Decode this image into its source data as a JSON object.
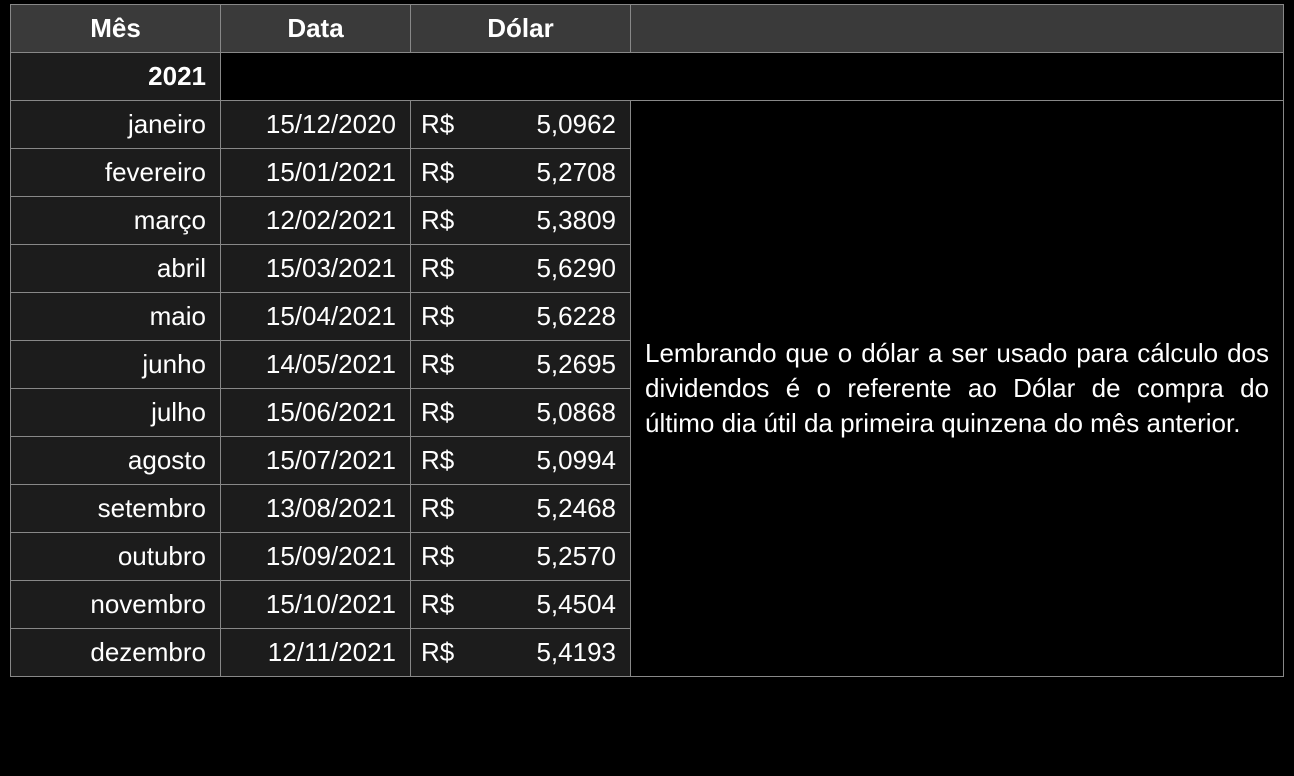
{
  "headers": {
    "month": "Mês",
    "date": "Data",
    "dollar": "Dólar"
  },
  "year": "2021",
  "currency_symbol": "R$",
  "rows": [
    {
      "month": "janeiro",
      "date": "15/12/2020",
      "value": "5,0962"
    },
    {
      "month": "fevereiro",
      "date": "15/01/2021",
      "value": "5,2708"
    },
    {
      "month": "março",
      "date": "12/02/2021",
      "value": "5,3809"
    },
    {
      "month": "abril",
      "date": "15/03/2021",
      "value": "5,6290"
    },
    {
      "month": "maio",
      "date": "15/04/2021",
      "value": "5,6228"
    },
    {
      "month": "junho",
      "date": "14/05/2021",
      "value": "5,2695"
    },
    {
      "month": "julho",
      "date": "15/06/2021",
      "value": "5,0868"
    },
    {
      "month": "agosto",
      "date": "15/07/2021",
      "value": "5,0994"
    },
    {
      "month": "setembro",
      "date": "13/08/2021",
      "value": "5,2468"
    },
    {
      "month": "outubro",
      "date": "15/09/2021",
      "value": "5,2570"
    },
    {
      "month": "novembro",
      "date": "15/10/2021",
      "value": "5,4504"
    },
    {
      "month": "dezembro",
      "date": "12/11/2021",
      "value": "5,4193"
    }
  ],
  "note": "Lembrando que o dólar a ser usado para cálculo dos dividendos é o referente ao Dólar de compra do último dia útil da primeira quinzena do mês anterior."
}
